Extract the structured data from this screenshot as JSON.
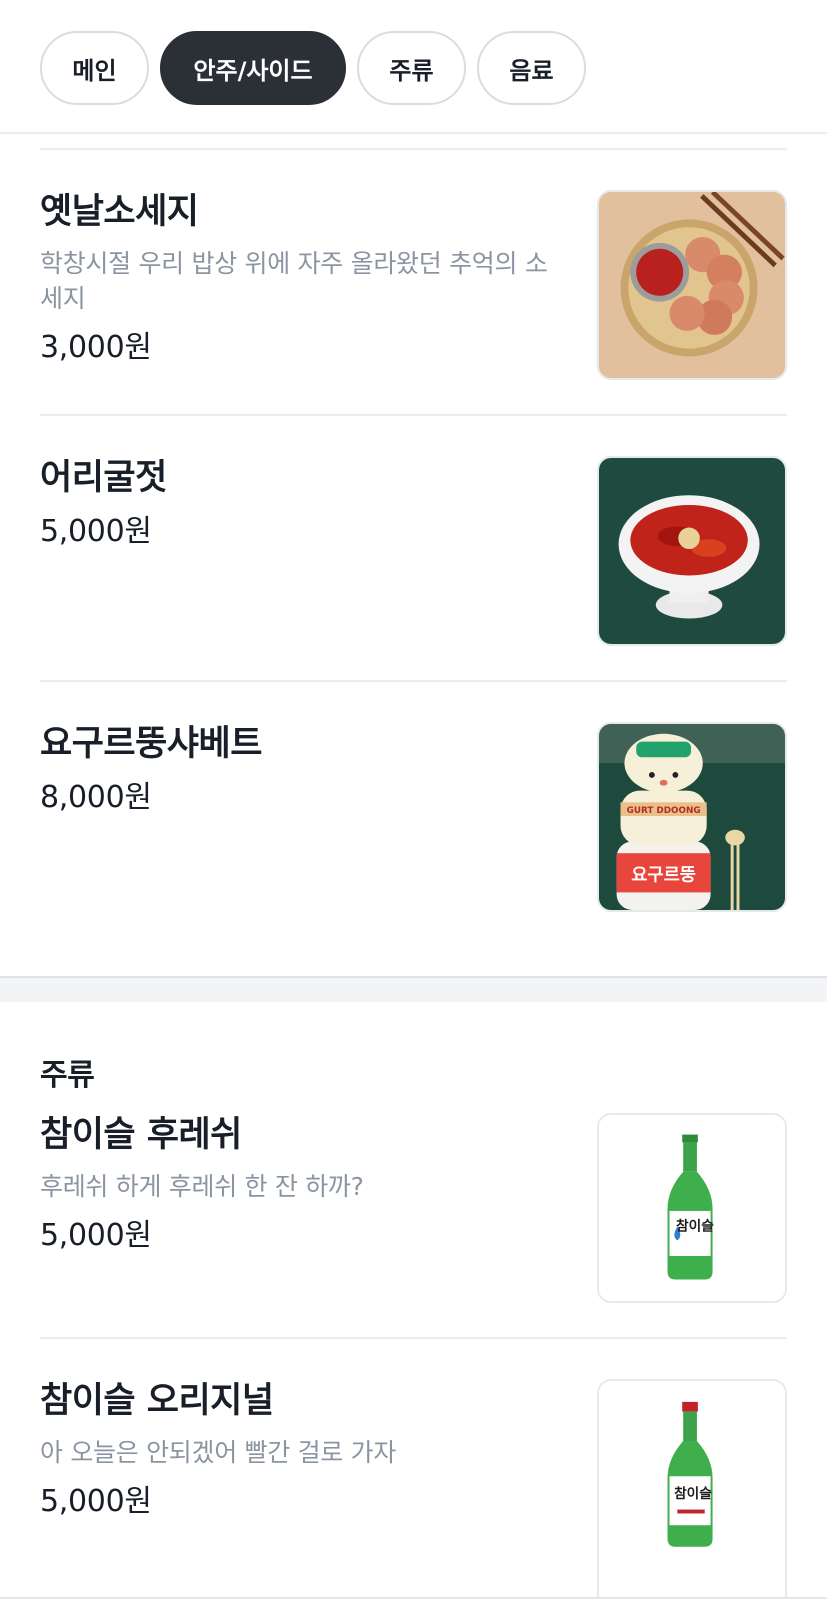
{
  "tabs": [
    {
      "label": "메인",
      "active": false
    },
    {
      "label": "안주/사이드",
      "active": true
    },
    {
      "label": "주류",
      "active": false
    },
    {
      "label": "음료",
      "active": false
    }
  ],
  "side_items": [
    {
      "name": "옛날소세지",
      "description": "학창시절 우리 밥상 위에 자주 올라왔던 추억의 소세지",
      "price": "3,000원",
      "image": "sausage-plate-photo"
    },
    {
      "name": "어리굴젓",
      "description": "",
      "price": "5,000원",
      "image": "spicy-oyster-bowl-photo"
    },
    {
      "name": "요구르뚱샤베트",
      "description": "",
      "price": "8,000원",
      "image": "yogurt-sherbet-photo"
    }
  ],
  "liquor_section": {
    "title": "주류",
    "items": [
      {
        "name": "참이슬 후레쉬",
        "description": "후레쉬 하게 후레쉬 한 잔 하까?",
        "price": "5,000원",
        "image": "soju-fresh-bottle-photo"
      },
      {
        "name": "참이슬 오리지널",
        "description": "아 오늘은 안되겠어 빨간 걸로 가자",
        "price": "5,000원",
        "image": "soju-original-bottle-photo"
      }
    ]
  },
  "image_text": {
    "yogurt_label": "GURT DDOONG",
    "yogurt_brand": "요구르뚱",
    "soju_brand": "참이슬"
  },
  "colors": {
    "active_tab_bg": "#2b2f36",
    "text_primary": "#191f28",
    "text_secondary": "#8b95a1",
    "divider": "#ebeef1"
  }
}
